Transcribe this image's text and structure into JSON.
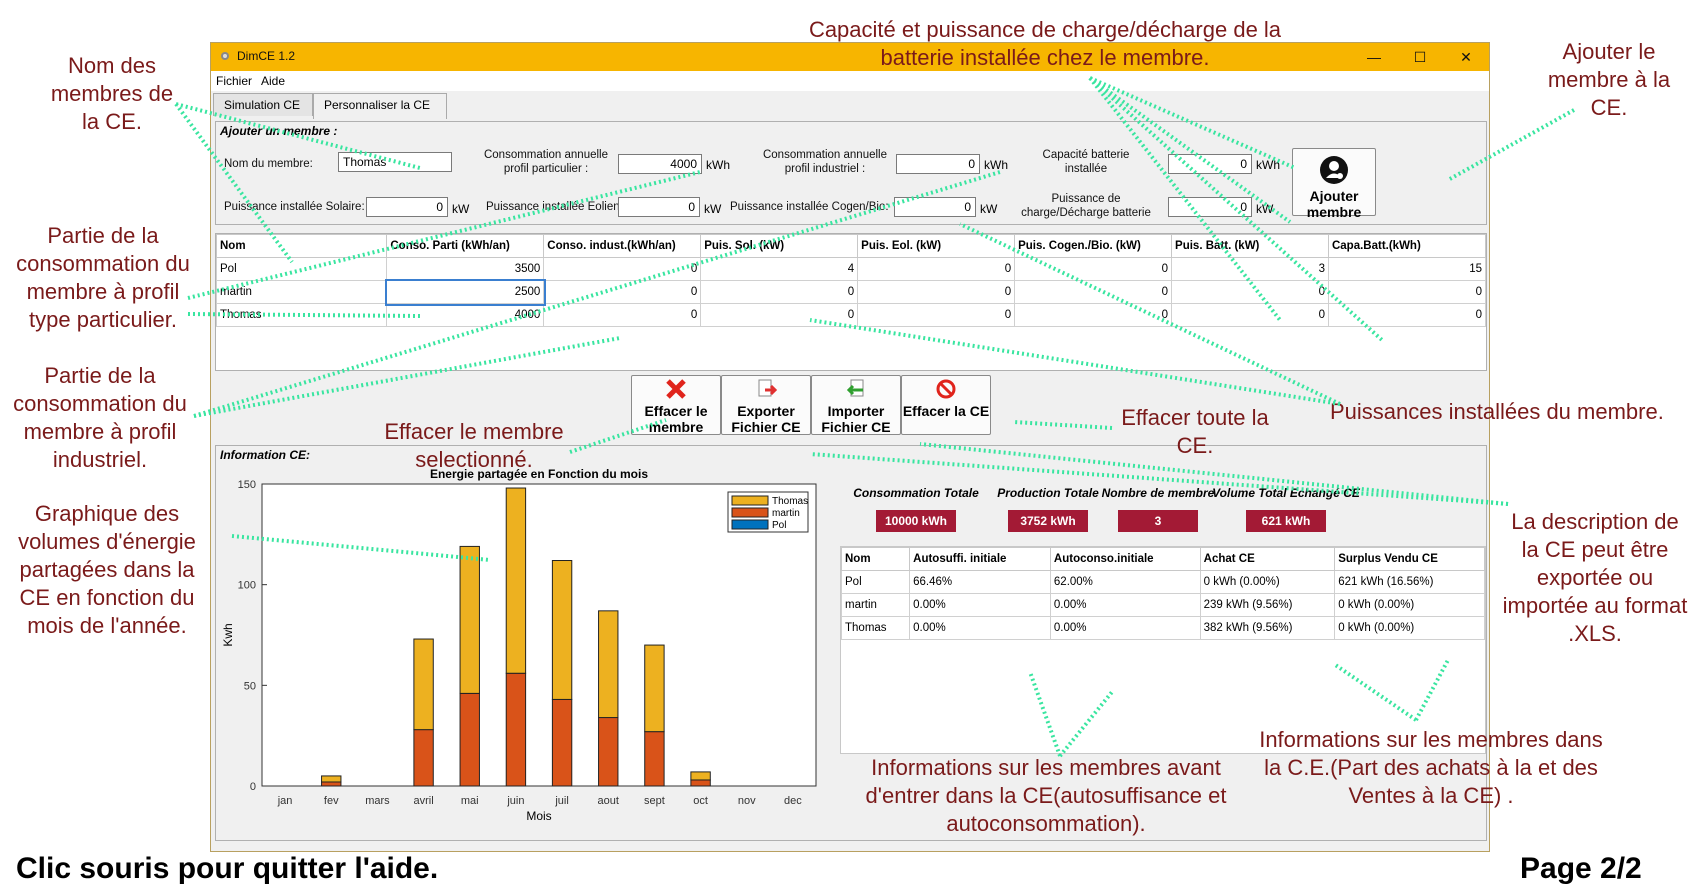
{
  "window": {
    "title": "DimCE  1.2",
    "menu": [
      "Fichier",
      "Aide"
    ],
    "tabs": [
      {
        "label": "Simulation CE"
      },
      {
        "label": "Personnaliser la CE",
        "active": true
      }
    ]
  },
  "add_member": {
    "section_title": "Ajouter un  membre :",
    "name_label": "Nom du membre:",
    "name_value": "Thomas",
    "conso_part_label": "Consommation annuelle profil particulier :",
    "conso_part_value": "4000",
    "conso_part_unit": "kWh",
    "conso_ind_label": "Consommation annuelle profil industriel :",
    "conso_ind_value": "0",
    "conso_ind_unit": "kWh",
    "cap_batt_label": "Capacité batterie installée",
    "cap_batt_value": "0",
    "cap_batt_unit": "kWh",
    "sol_label": "Puissance installée Solaire:",
    "sol_value": "0",
    "sol_unit": "kW",
    "eol_label": "Puissance installée Eolien:",
    "eol_value": "0",
    "eol_unit": "kW",
    "cog_label": "Puissance installée Cogen/Bio:",
    "cog_value": "0",
    "cog_unit": "kW",
    "pbatt_label": "Puissance de charge/Décharge batterie",
    "pbatt_value": "0",
    "pbatt_unit": "kW",
    "add_button": "Ajouter membre"
  },
  "members_table": {
    "headers": [
      "Nom",
      "Conso. Parti (kWh/an)",
      "Conso. indust.(kWh/an)",
      "Puis. Sol. (kW)",
      "Puis. Eol. (kW)",
      "Puis. Cogen./Bio. (kW)",
      "Puis. Batt. (kW)",
      "Capa.Batt.(kWh)"
    ],
    "rows": [
      [
        "Pol",
        "3500",
        "0",
        "4",
        "0",
        "0",
        "3",
        "15"
      ],
      [
        "martin",
        "2500",
        "0",
        "0",
        "0",
        "0",
        "0",
        "0"
      ],
      [
        "Thomas",
        "4000",
        "0",
        "0",
        "0",
        "0",
        "0",
        "0"
      ]
    ]
  },
  "actions": {
    "delete_member": "Effacer le membre",
    "export": "Exporter Fichier CE",
    "import": "Importer Fichier CE",
    "delete_ce": "Effacer la CE"
  },
  "info": {
    "section_title": "Information CE:",
    "stats": [
      {
        "label": "Consommation Totale",
        "value": "10000 kWh"
      },
      {
        "label": "Production Totale",
        "value": "3752 kWh"
      },
      {
        "label": "Nombre de membre",
        "value": "3"
      },
      {
        "label": "Volume Total Echangé CE",
        "value": "621 kWh"
      }
    ],
    "table_headers": [
      "Nom",
      "Autosuffi. initiale",
      "Autoconso.initiale",
      "Achat CE",
      "Surplus Vendu CE"
    ],
    "table_rows": [
      [
        "Pol",
        "66.46%",
        "62.00%",
        "0 kWh (0.00%)",
        "621 kWh (16.56%)"
      ],
      [
        "martin",
        "0.00%",
        "0.00%",
        "239 kWh (9.56%)",
        "0 kWh (0.00%)"
      ],
      [
        "Thomas",
        "0.00%",
        "0.00%",
        "382 kWh (9.56%)",
        "0 kWh (0.00%)"
      ]
    ]
  },
  "chart_data": {
    "type": "bar",
    "title": "Energie partagée en Fonction du mois",
    "xlabel": "Mois",
    "ylabel": "Kwh",
    "ylim": [
      0,
      150
    ],
    "yticks": [
      0,
      50,
      100,
      150
    ],
    "categories": [
      "jan",
      "fev",
      "mars",
      "avril",
      "mai",
      "juin",
      "juil",
      "aout",
      "sept",
      "oct",
      "nov",
      "dec"
    ],
    "stacked": true,
    "legend_position": "top-right",
    "series": [
      {
        "name": "Pol",
        "color": "#0072bd",
        "values": [
          0,
          0,
          0,
          0,
          0,
          0,
          0,
          0,
          0,
          0,
          0,
          0
        ]
      },
      {
        "name": "martin",
        "color": "#d95319",
        "values": [
          0,
          2,
          0,
          28,
          46,
          56,
          43,
          34,
          27,
          3,
          0,
          0
        ]
      },
      {
        "name": "Thomas",
        "color": "#edb120",
        "values": [
          0,
          3,
          0,
          45,
          73,
          92,
          69,
          53,
          43,
          4,
          0,
          0
        ]
      }
    ]
  },
  "annotations": [
    "Nom des membres de la CE.",
    "Capacité et puissance de charge/décharge de la batterie installée chez le membre.",
    "Ajouter le membre à la CE.",
    "Partie de la consommation du membre à profil type particulier.",
    "Partie de la consommation du membre à profil industriel.",
    "Effacer le membre selectionné.",
    "Effacer toute la CE.",
    "Puissances installées du membre.",
    "Graphique des volumes d'énergie partagées dans la CE en fonction du mois de l'année.",
    "La description de la CE peut être exportée ou importée au format .XLS.",
    "Informations sur les membres avant d'entrer dans la CE(autosuffisance et autoconsommation).",
    "Informations sur les membres dans la C.E.(Part des achats à la et des Ventes à la CE) ."
  ],
  "footer": {
    "quit": "Clic souris pour quitter l'aide.",
    "page": "Page 2/2"
  }
}
